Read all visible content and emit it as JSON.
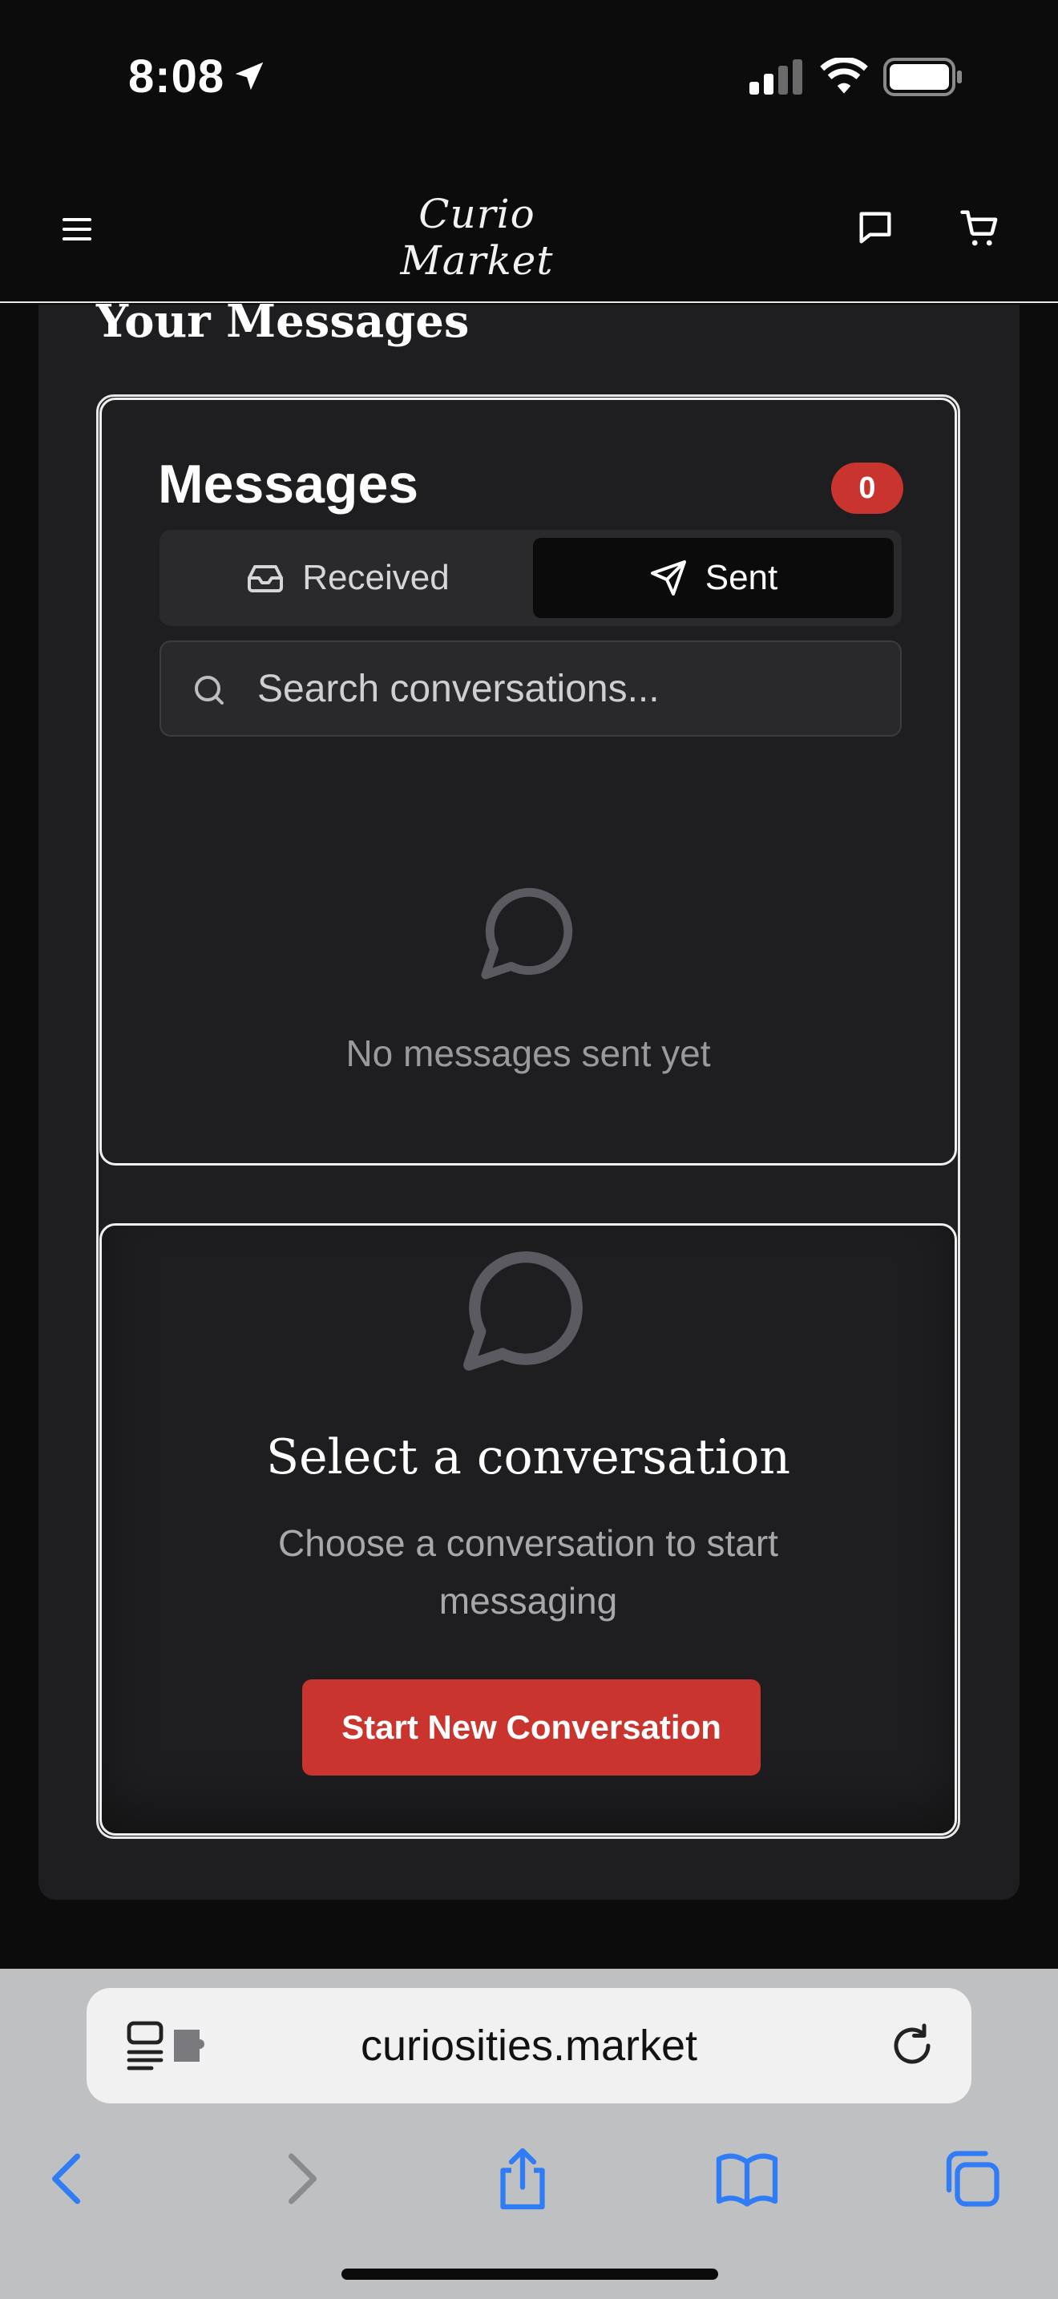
{
  "status_bar": {
    "time": "8:08"
  },
  "header": {
    "brand": "Curio Market",
    "icons": [
      "menu-icon",
      "chat-icon",
      "cart-icon"
    ]
  },
  "page": {
    "section_title": "Your Messages"
  },
  "messages": {
    "heading": "Messages",
    "count": "0",
    "tabs": [
      {
        "label": "Received",
        "icon": "inbox-icon",
        "active": false
      },
      {
        "label": "Sent",
        "icon": "send-icon",
        "active": true
      }
    ],
    "search_placeholder": "Search conversations...",
    "empty_text": "No messages sent yet"
  },
  "conversation_panel": {
    "title": "Select a conversation",
    "subtitle": "Choose a conversation to start messaging",
    "button_label": "Start New Conversation"
  },
  "browser": {
    "url": "curiosities.market"
  },
  "colors": {
    "accent_red": "#c9352e",
    "background": "#0c0c0d",
    "panel": "#1e1e20",
    "browser_blue": "#2f7cf6"
  }
}
